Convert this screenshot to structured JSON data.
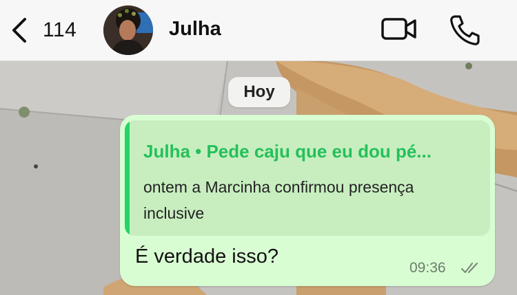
{
  "header": {
    "back_count": "114",
    "contact_name": "Julha",
    "icons": [
      "chevron-left-icon",
      "video-camera-icon",
      "phone-icon"
    ]
  },
  "chat": {
    "date_label": "Hoy",
    "message": {
      "quoted": {
        "title": "Julha • Pede caju que eu dou pé...",
        "text": "ontem a Marcinha confirmou presença inclusive"
      },
      "text": "É verdade isso?",
      "time": "09:36",
      "status": "read-double-check"
    }
  },
  "colors": {
    "bubble": "#d9fdd3",
    "quote_bg": "#c8eec0",
    "quote_accent": "#25d366",
    "header_bg": "#f7f7f7"
  }
}
